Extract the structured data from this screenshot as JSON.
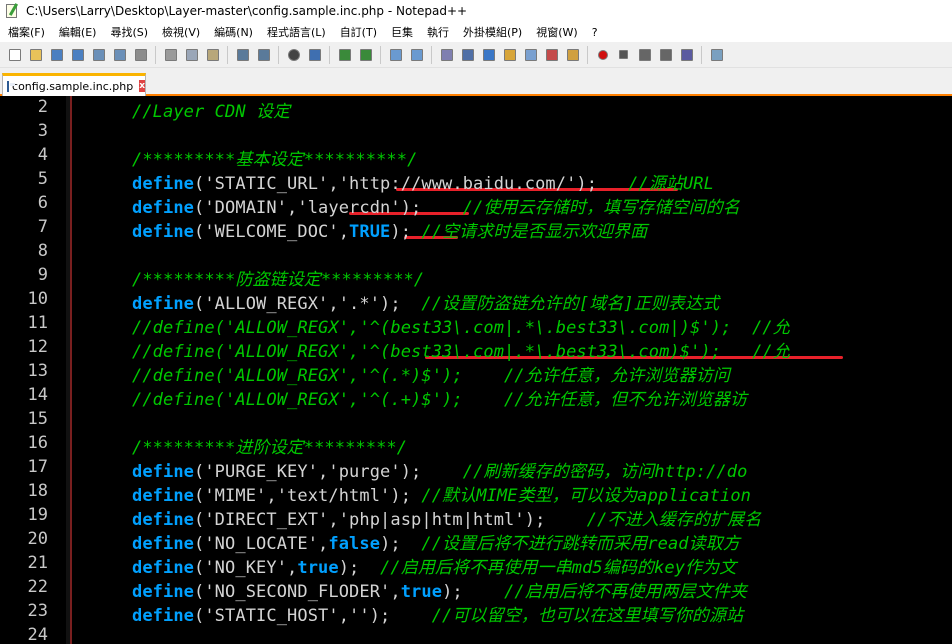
{
  "window": {
    "title": "C:\\Users\\Larry\\Desktop\\Layer-master\\config.sample.inc.php - Notepad++"
  },
  "menu": [
    "檔案(F)",
    "編輯(E)",
    "尋找(S)",
    "檢視(V)",
    "編碼(N)",
    "程式語言(L)",
    "自訂(T)",
    "巨集",
    "執行",
    "外掛模組(P)",
    "視窗(W)",
    "?"
  ],
  "tab": {
    "label": "config.sample.inc.php",
    "close": "x"
  },
  "colors": {
    "background": "#000000",
    "keyword": "#00a0ff",
    "comment": "#00c800",
    "string": "#d4d4d4",
    "underline": "#e8212a",
    "active_tab_accent": "#fab400"
  },
  "toolbar_icons": [
    "new-file-icon",
    "open-file-icon",
    "save-icon",
    "save-all-icon",
    "close-icon",
    "close-all-icon",
    "print-icon",
    "cut-icon",
    "copy-icon",
    "paste-icon",
    "undo-icon",
    "redo-icon",
    "find-icon",
    "replace-icon",
    "zoom-in-icon",
    "zoom-out-icon",
    "sync-vertical-icon",
    "sync-horizontal-icon",
    "word-wrap-icon",
    "show-all-chars-icon",
    "indent-guide-icon",
    "user-lang-icon",
    "doc-map-icon",
    "function-list-icon",
    "folder-workspace-icon",
    "record-macro-icon",
    "stop-macro-icon",
    "play-macro-icon",
    "run-macro-multiple-icon",
    "save-macro-icon",
    "launch-browser-icon"
  ],
  "lines": [
    {
      "n": "2",
      "parts": [
        {
          "t": "//Layer CDN 设定",
          "c": "cmt"
        }
      ]
    },
    {
      "n": "3",
      "parts": []
    },
    {
      "n": "4",
      "parts": [
        {
          "t": "/*********基本设定**********/",
          "c": "cmt"
        }
      ]
    },
    {
      "n": "5",
      "parts": [
        {
          "t": "define",
          "c": "kw"
        },
        {
          "t": "('STATIC_URL','http://www.baidu.com/');   ",
          "c": "str"
        },
        {
          "t": "//源站URL",
          "c": "cmt"
        }
      ]
    },
    {
      "n": "6",
      "parts": [
        {
          "t": "define",
          "c": "kw"
        },
        {
          "t": "('DOMAIN','layercdn');    ",
          "c": "str"
        },
        {
          "t": "//使用云存储时，填写存储空间的名",
          "c": "cmt"
        }
      ]
    },
    {
      "n": "7",
      "parts": [
        {
          "t": "define",
          "c": "kw"
        },
        {
          "t": "('WELCOME_DOC',",
          "c": "str"
        },
        {
          "t": "TRUE",
          "c": "bool"
        },
        {
          "t": "); ",
          "c": "str"
        },
        {
          "t": "//空请求时是否显示欢迎界面",
          "c": "cmt"
        }
      ]
    },
    {
      "n": "8",
      "parts": []
    },
    {
      "n": "9",
      "parts": [
        {
          "t": "/*********防盗链设定*********/",
          "c": "cmt"
        }
      ]
    },
    {
      "n": "10",
      "parts": [
        {
          "t": "define",
          "c": "kw"
        },
        {
          "t": "('ALLOW_REGX','.*');  ",
          "c": "str"
        },
        {
          "t": "//设置防盗链允许的[域名]正则表达式",
          "c": "cmt"
        }
      ]
    },
    {
      "n": "11",
      "parts": [
        {
          "t": "//define('ALLOW_REGX','^(best33\\.com|.*\\.best33\\.com|)$');  //允",
          "c": "cmt"
        }
      ]
    },
    {
      "n": "12",
      "parts": [
        {
          "t": "//define('ALLOW_REGX','^(best33\\.com|.*\\.best33\\.com)$');   //允",
          "c": "cmt"
        }
      ]
    },
    {
      "n": "13",
      "parts": [
        {
          "t": "//define('ALLOW_REGX','^(.*)$');    //允许任意，允许浏览器访问",
          "c": "cmt"
        }
      ]
    },
    {
      "n": "14",
      "parts": [
        {
          "t": "//define('ALLOW_REGX','^(.+)$');    //允许任意，但不允许浏览器访",
          "c": "cmt"
        }
      ]
    },
    {
      "n": "15",
      "parts": []
    },
    {
      "n": "16",
      "parts": [
        {
          "t": "/*********进阶设定*********/",
          "c": "cmt"
        }
      ]
    },
    {
      "n": "17",
      "parts": [
        {
          "t": "define",
          "c": "kw"
        },
        {
          "t": "('PURGE_KEY','purge');    ",
          "c": "str"
        },
        {
          "t": "//刷新缓存的密码，访问http://do",
          "c": "cmt"
        }
      ]
    },
    {
      "n": "18",
      "parts": [
        {
          "t": "define",
          "c": "kw"
        },
        {
          "t": "('MIME','text/html'); ",
          "c": "str"
        },
        {
          "t": "//默认MIME类型，可以设为application",
          "c": "cmt"
        }
      ]
    },
    {
      "n": "19",
      "parts": [
        {
          "t": "define",
          "c": "kw"
        },
        {
          "t": "('DIRECT_EXT','php|asp|htm|html');    ",
          "c": "str"
        },
        {
          "t": "//不进入缓存的扩展名",
          "c": "cmt"
        }
      ]
    },
    {
      "n": "20",
      "parts": [
        {
          "t": "define",
          "c": "kw"
        },
        {
          "t": "('NO_LOCATE',",
          "c": "str"
        },
        {
          "t": "false",
          "c": "bool"
        },
        {
          "t": ");  ",
          "c": "str"
        },
        {
          "t": "//设置后将不进行跳转而采用read读取方",
          "c": "cmt"
        }
      ]
    },
    {
      "n": "21",
      "parts": [
        {
          "t": "define",
          "c": "kw"
        },
        {
          "t": "('NO_KEY',",
          "c": "str"
        },
        {
          "t": "true",
          "c": "bool"
        },
        {
          "t": ");  ",
          "c": "str"
        },
        {
          "t": "//启用后将不再使用一串md5编码的key作为文",
          "c": "cmt"
        }
      ]
    },
    {
      "n": "22",
      "parts": [
        {
          "t": "define",
          "c": "kw"
        },
        {
          "t": "('NO_SECOND_FLODER',",
          "c": "str"
        },
        {
          "t": "true",
          "c": "bool"
        },
        {
          "t": ");    ",
          "c": "str"
        },
        {
          "t": "//启用后将不再使用两层文件夹",
          "c": "cmt"
        }
      ]
    },
    {
      "n": "23",
      "parts": [
        {
          "t": "define",
          "c": "kw"
        },
        {
          "t": "('STATIC_HOST','');    ",
          "c": "str"
        },
        {
          "t": "//可以留空，也可以在这里填写你的源站",
          "c": "cmt"
        }
      ]
    },
    {
      "n": "24",
      "parts": []
    }
  ]
}
